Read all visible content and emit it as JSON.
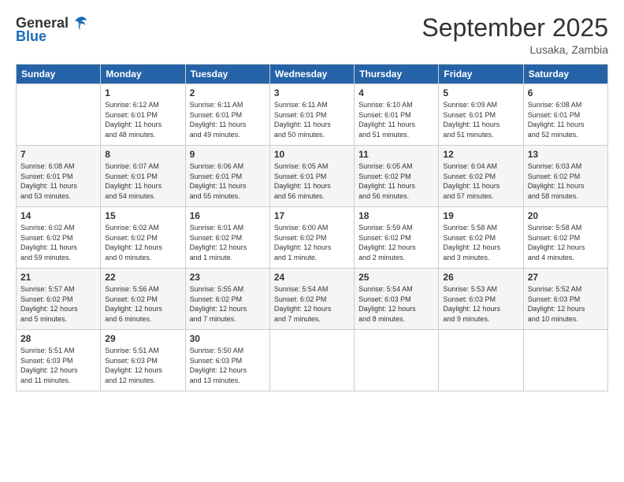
{
  "logo": {
    "general": "General",
    "blue": "Blue"
  },
  "header": {
    "title": "September 2025",
    "location": "Lusaka, Zambia"
  },
  "days_of_week": [
    "Sunday",
    "Monday",
    "Tuesday",
    "Wednesday",
    "Thursday",
    "Friday",
    "Saturday"
  ],
  "weeks": [
    [
      {
        "day": "",
        "info": ""
      },
      {
        "day": "1",
        "info": "Sunrise: 6:12 AM\nSunset: 6:01 PM\nDaylight: 11 hours\nand 48 minutes."
      },
      {
        "day": "2",
        "info": "Sunrise: 6:11 AM\nSunset: 6:01 PM\nDaylight: 11 hours\nand 49 minutes."
      },
      {
        "day": "3",
        "info": "Sunrise: 6:11 AM\nSunset: 6:01 PM\nDaylight: 11 hours\nand 50 minutes."
      },
      {
        "day": "4",
        "info": "Sunrise: 6:10 AM\nSunset: 6:01 PM\nDaylight: 11 hours\nand 51 minutes."
      },
      {
        "day": "5",
        "info": "Sunrise: 6:09 AM\nSunset: 6:01 PM\nDaylight: 11 hours\nand 51 minutes."
      },
      {
        "day": "6",
        "info": "Sunrise: 6:08 AM\nSunset: 6:01 PM\nDaylight: 11 hours\nand 52 minutes."
      }
    ],
    [
      {
        "day": "7",
        "info": "Sunrise: 6:08 AM\nSunset: 6:01 PM\nDaylight: 11 hours\nand 53 minutes."
      },
      {
        "day": "8",
        "info": "Sunrise: 6:07 AM\nSunset: 6:01 PM\nDaylight: 11 hours\nand 54 minutes."
      },
      {
        "day": "9",
        "info": "Sunrise: 6:06 AM\nSunset: 6:01 PM\nDaylight: 11 hours\nand 55 minutes."
      },
      {
        "day": "10",
        "info": "Sunrise: 6:05 AM\nSunset: 6:01 PM\nDaylight: 11 hours\nand 56 minutes."
      },
      {
        "day": "11",
        "info": "Sunrise: 6:05 AM\nSunset: 6:02 PM\nDaylight: 11 hours\nand 56 minutes."
      },
      {
        "day": "12",
        "info": "Sunrise: 6:04 AM\nSunset: 6:02 PM\nDaylight: 11 hours\nand 57 minutes."
      },
      {
        "day": "13",
        "info": "Sunrise: 6:03 AM\nSunset: 6:02 PM\nDaylight: 11 hours\nand 58 minutes."
      }
    ],
    [
      {
        "day": "14",
        "info": "Sunrise: 6:02 AM\nSunset: 6:02 PM\nDaylight: 11 hours\nand 59 minutes."
      },
      {
        "day": "15",
        "info": "Sunrise: 6:02 AM\nSunset: 6:02 PM\nDaylight: 12 hours\nand 0 minutes."
      },
      {
        "day": "16",
        "info": "Sunrise: 6:01 AM\nSunset: 6:02 PM\nDaylight: 12 hours\nand 1 minute."
      },
      {
        "day": "17",
        "info": "Sunrise: 6:00 AM\nSunset: 6:02 PM\nDaylight: 12 hours\nand 1 minute."
      },
      {
        "day": "18",
        "info": "Sunrise: 5:59 AM\nSunset: 6:02 PM\nDaylight: 12 hours\nand 2 minutes."
      },
      {
        "day": "19",
        "info": "Sunrise: 5:58 AM\nSunset: 6:02 PM\nDaylight: 12 hours\nand 3 minutes."
      },
      {
        "day": "20",
        "info": "Sunrise: 5:58 AM\nSunset: 6:02 PM\nDaylight: 12 hours\nand 4 minutes."
      }
    ],
    [
      {
        "day": "21",
        "info": "Sunrise: 5:57 AM\nSunset: 6:02 PM\nDaylight: 12 hours\nand 5 minutes."
      },
      {
        "day": "22",
        "info": "Sunrise: 5:56 AM\nSunset: 6:02 PM\nDaylight: 12 hours\nand 6 minutes."
      },
      {
        "day": "23",
        "info": "Sunrise: 5:55 AM\nSunset: 6:02 PM\nDaylight: 12 hours\nand 7 minutes."
      },
      {
        "day": "24",
        "info": "Sunrise: 5:54 AM\nSunset: 6:02 PM\nDaylight: 12 hours\nand 7 minutes."
      },
      {
        "day": "25",
        "info": "Sunrise: 5:54 AM\nSunset: 6:03 PM\nDaylight: 12 hours\nand 8 minutes."
      },
      {
        "day": "26",
        "info": "Sunrise: 5:53 AM\nSunset: 6:03 PM\nDaylight: 12 hours\nand 9 minutes."
      },
      {
        "day": "27",
        "info": "Sunrise: 5:52 AM\nSunset: 6:03 PM\nDaylight: 12 hours\nand 10 minutes."
      }
    ],
    [
      {
        "day": "28",
        "info": "Sunrise: 5:51 AM\nSunset: 6:03 PM\nDaylight: 12 hours\nand 11 minutes."
      },
      {
        "day": "29",
        "info": "Sunrise: 5:51 AM\nSunset: 6:03 PM\nDaylight: 12 hours\nand 12 minutes."
      },
      {
        "day": "30",
        "info": "Sunrise: 5:50 AM\nSunset: 6:03 PM\nDaylight: 12 hours\nand 13 minutes."
      },
      {
        "day": "",
        "info": ""
      },
      {
        "day": "",
        "info": ""
      },
      {
        "day": "",
        "info": ""
      },
      {
        "day": "",
        "info": ""
      }
    ]
  ]
}
